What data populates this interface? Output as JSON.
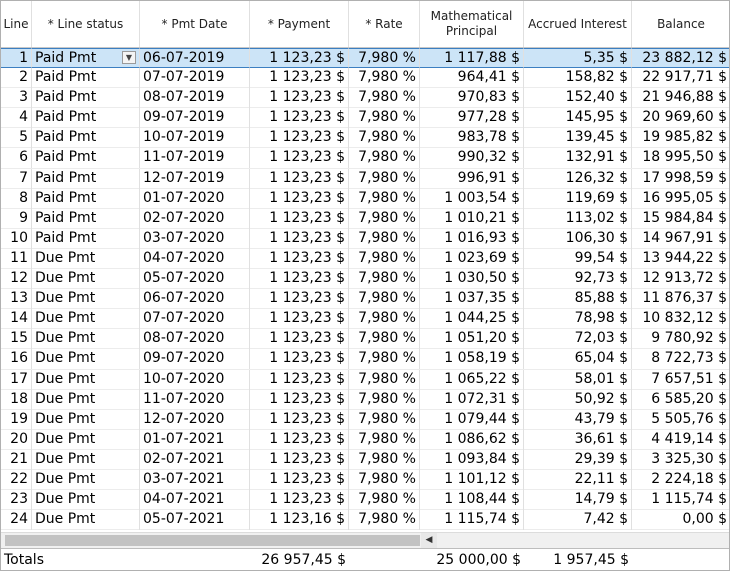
{
  "headers": {
    "line": "Line",
    "status": "* Line status",
    "date": "* Pmt Date",
    "payment": "* Payment",
    "rate": "* Rate",
    "principal": "Mathematical\nPrincipal",
    "interest": "Accrued Interest",
    "balance": "Balance"
  },
  "rows": [
    {
      "line": "1",
      "status": "Paid Pmt",
      "date": "06-07-2019",
      "payment": "1 123,23 $",
      "rate": "7,980 %",
      "principal": "1 117,88 $",
      "interest": "5,35 $",
      "balance": "23 882,12 $"
    },
    {
      "line": "2",
      "status": "Paid Pmt",
      "date": "07-07-2019",
      "payment": "1 123,23 $",
      "rate": "7,980 %",
      "principal": "964,41 $",
      "interest": "158,82 $",
      "balance": "22 917,71 $"
    },
    {
      "line": "3",
      "status": "Paid Pmt",
      "date": "08-07-2019",
      "payment": "1 123,23 $",
      "rate": "7,980 %",
      "principal": "970,83 $",
      "interest": "152,40 $",
      "balance": "21 946,88 $"
    },
    {
      "line": "4",
      "status": "Paid Pmt",
      "date": "09-07-2019",
      "payment": "1 123,23 $",
      "rate": "7,980 %",
      "principal": "977,28 $",
      "interest": "145,95 $",
      "balance": "20 969,60 $"
    },
    {
      "line": "5",
      "status": "Paid Pmt",
      "date": "10-07-2019",
      "payment": "1 123,23 $",
      "rate": "7,980 %",
      "principal": "983,78 $",
      "interest": "139,45 $",
      "balance": "19 985,82 $"
    },
    {
      "line": "6",
      "status": "Paid Pmt",
      "date": "11-07-2019",
      "payment": "1 123,23 $",
      "rate": "7,980 %",
      "principal": "990,32 $",
      "interest": "132,91 $",
      "balance": "18 995,50 $"
    },
    {
      "line": "7",
      "status": "Paid Pmt",
      "date": "12-07-2019",
      "payment": "1 123,23 $",
      "rate": "7,980 %",
      "principal": "996,91 $",
      "interest": "126,32 $",
      "balance": "17 998,59 $"
    },
    {
      "line": "8",
      "status": "Paid Pmt",
      "date": "01-07-2020",
      "payment": "1 123,23 $",
      "rate": "7,980 %",
      "principal": "1 003,54 $",
      "interest": "119,69 $",
      "balance": "16 995,05 $"
    },
    {
      "line": "9",
      "status": "Paid Pmt",
      "date": "02-07-2020",
      "payment": "1 123,23 $",
      "rate": "7,980 %",
      "principal": "1 010,21 $",
      "interest": "113,02 $",
      "balance": "15 984,84 $"
    },
    {
      "line": "10",
      "status": "Paid Pmt",
      "date": "03-07-2020",
      "payment": "1 123,23 $",
      "rate": "7,980 %",
      "principal": "1 016,93 $",
      "interest": "106,30 $",
      "balance": "14 967,91 $"
    },
    {
      "line": "11",
      "status": "Due Pmt",
      "date": "04-07-2020",
      "payment": "1 123,23 $",
      "rate": "7,980 %",
      "principal": "1 023,69 $",
      "interest": "99,54 $",
      "balance": "13 944,22 $"
    },
    {
      "line": "12",
      "status": "Due Pmt",
      "date": "05-07-2020",
      "payment": "1 123,23 $",
      "rate": "7,980 %",
      "principal": "1 030,50 $",
      "interest": "92,73 $",
      "balance": "12 913,72 $"
    },
    {
      "line": "13",
      "status": "Due Pmt",
      "date": "06-07-2020",
      "payment": "1 123,23 $",
      "rate": "7,980 %",
      "principal": "1 037,35 $",
      "interest": "85,88 $",
      "balance": "11 876,37 $"
    },
    {
      "line": "14",
      "status": "Due Pmt",
      "date": "07-07-2020",
      "payment": "1 123,23 $",
      "rate": "7,980 %",
      "principal": "1 044,25 $",
      "interest": "78,98 $",
      "balance": "10 832,12 $"
    },
    {
      "line": "15",
      "status": "Due Pmt",
      "date": "08-07-2020",
      "payment": "1 123,23 $",
      "rate": "7,980 %",
      "principal": "1 051,20 $",
      "interest": "72,03 $",
      "balance": "9 780,92 $"
    },
    {
      "line": "16",
      "status": "Due Pmt",
      "date": "09-07-2020",
      "payment": "1 123,23 $",
      "rate": "7,980 %",
      "principal": "1 058,19 $",
      "interest": "65,04 $",
      "balance": "8 722,73 $"
    },
    {
      "line": "17",
      "status": "Due Pmt",
      "date": "10-07-2020",
      "payment": "1 123,23 $",
      "rate": "7,980 %",
      "principal": "1 065,22 $",
      "interest": "58,01 $",
      "balance": "7 657,51 $"
    },
    {
      "line": "18",
      "status": "Due Pmt",
      "date": "11-07-2020",
      "payment": "1 123,23 $",
      "rate": "7,980 %",
      "principal": "1 072,31 $",
      "interest": "50,92 $",
      "balance": "6 585,20 $"
    },
    {
      "line": "19",
      "status": "Due Pmt",
      "date": "12-07-2020",
      "payment": "1 123,23 $",
      "rate": "7,980 %",
      "principal": "1 079,44 $",
      "interest": "43,79 $",
      "balance": "5 505,76 $"
    },
    {
      "line": "20",
      "status": "Due Pmt",
      "date": "01-07-2021",
      "payment": "1 123,23 $",
      "rate": "7,980 %",
      "principal": "1 086,62 $",
      "interest": "36,61 $",
      "balance": "4 419,14 $"
    },
    {
      "line": "21",
      "status": "Due Pmt",
      "date": "02-07-2021",
      "payment": "1 123,23 $",
      "rate": "7,980 %",
      "principal": "1 093,84 $",
      "interest": "29,39 $",
      "balance": "3 325,30 $"
    },
    {
      "line": "22",
      "status": "Due Pmt",
      "date": "03-07-2021",
      "payment": "1 123,23 $",
      "rate": "7,980 %",
      "principal": "1 101,12 $",
      "interest": "22,11 $",
      "balance": "2 224,18 $"
    },
    {
      "line": "23",
      "status": "Due Pmt",
      "date": "04-07-2021",
      "payment": "1 123,23 $",
      "rate": "7,980 %",
      "principal": "1 108,44 $",
      "interest": "14,79 $",
      "balance": "1 115,74 $"
    },
    {
      "line": "24",
      "status": "Due Pmt",
      "date": "05-07-2021",
      "payment": "1 123,16 $",
      "rate": "7,980 %",
      "principal": "1 115,74 $",
      "interest": "7,42 $",
      "balance": "0,00 $"
    }
  ],
  "selected_row": 0,
  "totals": {
    "label": "Totals",
    "payment": "26 957,45 $",
    "principal": "25 000,00 $",
    "interest": "1 957,45 $"
  },
  "icons": {
    "dropdown": "chevron-down-icon",
    "scroll_left": "arrow-left-icon"
  },
  "colors": {
    "selection": "#cce4f7",
    "selection_border": "#3c7fc1"
  }
}
